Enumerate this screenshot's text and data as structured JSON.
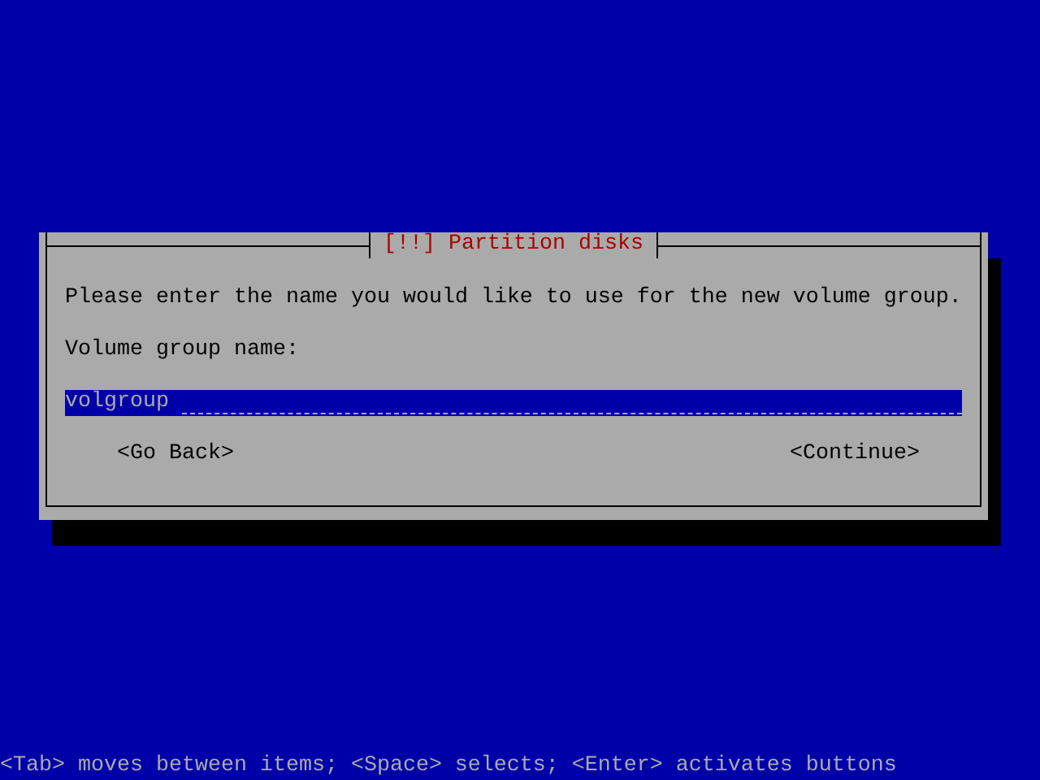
{
  "dialog": {
    "title": "[!!] Partition disks",
    "message": "Please enter the name you would like to use for the new volume group.",
    "field_label": "Volume group name:",
    "field": {
      "value": "volgroup"
    },
    "buttons": [
      "<Go Back>",
      "<Continue>"
    ]
  },
  "hint": "<Tab> moves between items; <Space> selects; <Enter> activates buttons"
}
